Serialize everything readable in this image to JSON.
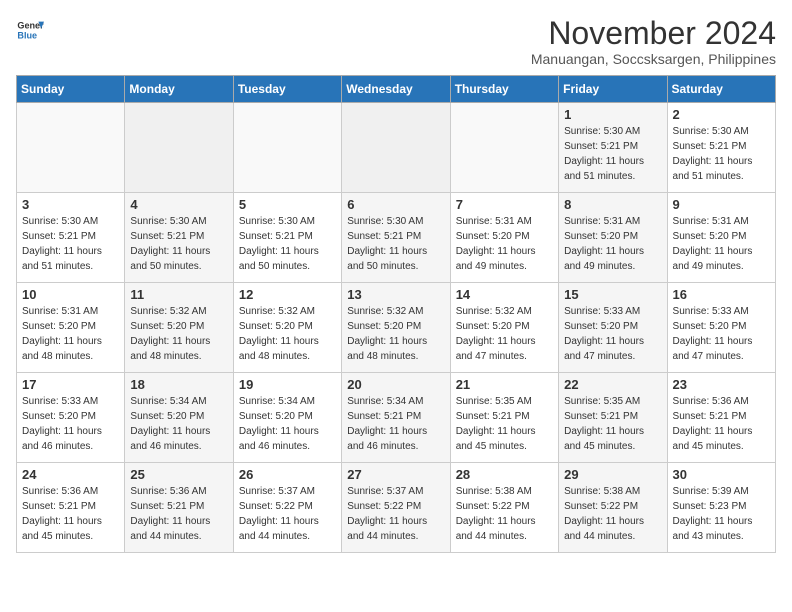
{
  "header": {
    "logo_line1": "General",
    "logo_line2": "Blue",
    "month_year": "November 2024",
    "location": "Manuangan, Soccsksargen, Philippines"
  },
  "weekdays": [
    "Sunday",
    "Monday",
    "Tuesday",
    "Wednesday",
    "Thursday",
    "Friday",
    "Saturday"
  ],
  "weeks": [
    [
      {
        "day": "",
        "info": ""
      },
      {
        "day": "",
        "info": ""
      },
      {
        "day": "",
        "info": ""
      },
      {
        "day": "",
        "info": ""
      },
      {
        "day": "",
        "info": ""
      },
      {
        "day": "1",
        "info": "Sunrise: 5:30 AM\nSunset: 5:21 PM\nDaylight: 11 hours\nand 51 minutes."
      },
      {
        "day": "2",
        "info": "Sunrise: 5:30 AM\nSunset: 5:21 PM\nDaylight: 11 hours\nand 51 minutes."
      }
    ],
    [
      {
        "day": "3",
        "info": "Sunrise: 5:30 AM\nSunset: 5:21 PM\nDaylight: 11 hours\nand 51 minutes."
      },
      {
        "day": "4",
        "info": "Sunrise: 5:30 AM\nSunset: 5:21 PM\nDaylight: 11 hours\nand 50 minutes."
      },
      {
        "day": "5",
        "info": "Sunrise: 5:30 AM\nSunset: 5:21 PM\nDaylight: 11 hours\nand 50 minutes."
      },
      {
        "day": "6",
        "info": "Sunrise: 5:30 AM\nSunset: 5:21 PM\nDaylight: 11 hours\nand 50 minutes."
      },
      {
        "day": "7",
        "info": "Sunrise: 5:31 AM\nSunset: 5:20 PM\nDaylight: 11 hours\nand 49 minutes."
      },
      {
        "day": "8",
        "info": "Sunrise: 5:31 AM\nSunset: 5:20 PM\nDaylight: 11 hours\nand 49 minutes."
      },
      {
        "day": "9",
        "info": "Sunrise: 5:31 AM\nSunset: 5:20 PM\nDaylight: 11 hours\nand 49 minutes."
      }
    ],
    [
      {
        "day": "10",
        "info": "Sunrise: 5:31 AM\nSunset: 5:20 PM\nDaylight: 11 hours\nand 48 minutes."
      },
      {
        "day": "11",
        "info": "Sunrise: 5:32 AM\nSunset: 5:20 PM\nDaylight: 11 hours\nand 48 minutes."
      },
      {
        "day": "12",
        "info": "Sunrise: 5:32 AM\nSunset: 5:20 PM\nDaylight: 11 hours\nand 48 minutes."
      },
      {
        "day": "13",
        "info": "Sunrise: 5:32 AM\nSunset: 5:20 PM\nDaylight: 11 hours\nand 48 minutes."
      },
      {
        "day": "14",
        "info": "Sunrise: 5:32 AM\nSunset: 5:20 PM\nDaylight: 11 hours\nand 47 minutes."
      },
      {
        "day": "15",
        "info": "Sunrise: 5:33 AM\nSunset: 5:20 PM\nDaylight: 11 hours\nand 47 minutes."
      },
      {
        "day": "16",
        "info": "Sunrise: 5:33 AM\nSunset: 5:20 PM\nDaylight: 11 hours\nand 47 minutes."
      }
    ],
    [
      {
        "day": "17",
        "info": "Sunrise: 5:33 AM\nSunset: 5:20 PM\nDaylight: 11 hours\nand 46 minutes."
      },
      {
        "day": "18",
        "info": "Sunrise: 5:34 AM\nSunset: 5:20 PM\nDaylight: 11 hours\nand 46 minutes."
      },
      {
        "day": "19",
        "info": "Sunrise: 5:34 AM\nSunset: 5:20 PM\nDaylight: 11 hours\nand 46 minutes."
      },
      {
        "day": "20",
        "info": "Sunrise: 5:34 AM\nSunset: 5:21 PM\nDaylight: 11 hours\nand 46 minutes."
      },
      {
        "day": "21",
        "info": "Sunrise: 5:35 AM\nSunset: 5:21 PM\nDaylight: 11 hours\nand 45 minutes."
      },
      {
        "day": "22",
        "info": "Sunrise: 5:35 AM\nSunset: 5:21 PM\nDaylight: 11 hours\nand 45 minutes."
      },
      {
        "day": "23",
        "info": "Sunrise: 5:36 AM\nSunset: 5:21 PM\nDaylight: 11 hours\nand 45 minutes."
      }
    ],
    [
      {
        "day": "24",
        "info": "Sunrise: 5:36 AM\nSunset: 5:21 PM\nDaylight: 11 hours\nand 45 minutes."
      },
      {
        "day": "25",
        "info": "Sunrise: 5:36 AM\nSunset: 5:21 PM\nDaylight: 11 hours\nand 44 minutes."
      },
      {
        "day": "26",
        "info": "Sunrise: 5:37 AM\nSunset: 5:22 PM\nDaylight: 11 hours\nand 44 minutes."
      },
      {
        "day": "27",
        "info": "Sunrise: 5:37 AM\nSunset: 5:22 PM\nDaylight: 11 hours\nand 44 minutes."
      },
      {
        "day": "28",
        "info": "Sunrise: 5:38 AM\nSunset: 5:22 PM\nDaylight: 11 hours\nand 44 minutes."
      },
      {
        "day": "29",
        "info": "Sunrise: 5:38 AM\nSunset: 5:22 PM\nDaylight: 11 hours\nand 44 minutes."
      },
      {
        "day": "30",
        "info": "Sunrise: 5:39 AM\nSunset: 5:23 PM\nDaylight: 11 hours\nand 43 minutes."
      }
    ]
  ]
}
